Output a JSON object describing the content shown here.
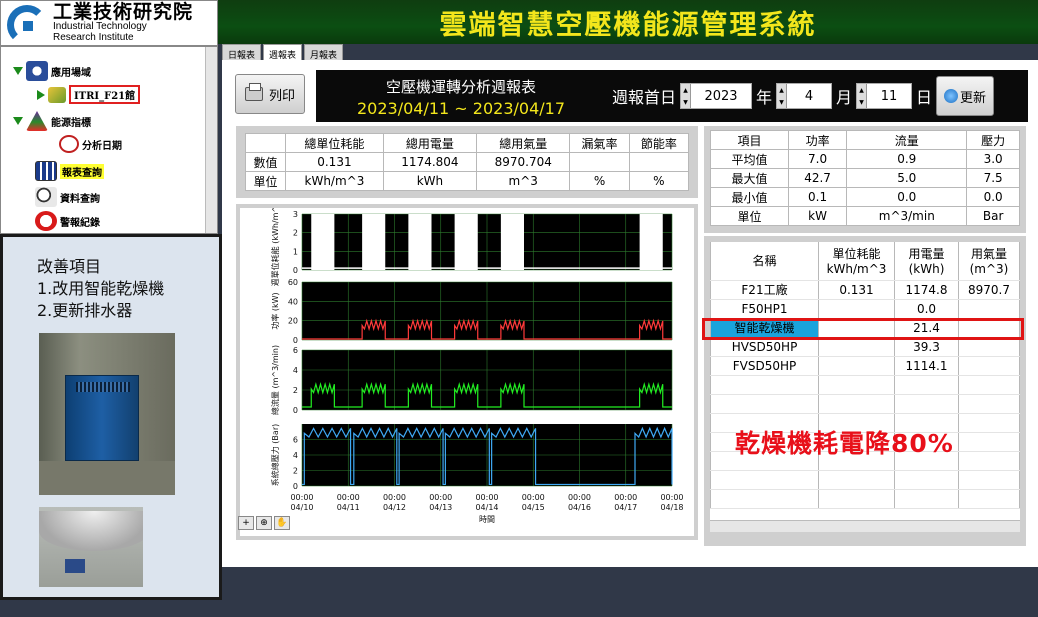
{
  "logo": {
    "zh": "工業技術研究院",
    "en1": "Industrial Technology",
    "en2": "Research Institute"
  },
  "app_title": "雲端智慧空壓機能源管理系統",
  "tree": {
    "app_site": "應用場域",
    "site_node": "ITRI_F21館",
    "energy_index": "能源指標",
    "analysis_date": "分析日期",
    "report_query": "報表查詢",
    "data_query": "資料查詢",
    "alarm_log": "警報紀錄"
  },
  "info": {
    "heading": "改善項目",
    "item1": "1.改用智能乾燥機",
    "item2": "2.更新排水器"
  },
  "tabs": [
    "日報表",
    "週報表",
    "月報表"
  ],
  "toolbar": {
    "print_label": "列印",
    "refresh_label": "更新"
  },
  "report": {
    "title": "空壓機運轉分析週報表",
    "range": "2023/04/11 ~ 2023/04/17"
  },
  "week": {
    "label": "週報首日",
    "year": "2023",
    "year_unit": "年",
    "month": "4",
    "month_unit": "月",
    "day": "11",
    "day_unit": "日"
  },
  "summary": {
    "headers": [
      "",
      "總單位耗能",
      "總用電量",
      "總用氣量",
      "漏氣率",
      "節能率"
    ],
    "rows": [
      [
        "數值",
        "0.131",
        "1174.804",
        "8970.704",
        "",
        ""
      ],
      [
        "單位",
        "kWh/m^3",
        "kWh",
        "m^3",
        "%",
        "%"
      ]
    ]
  },
  "stats": {
    "headers": [
      "項目",
      "功率",
      "流量",
      "壓力"
    ],
    "rows": [
      [
        "平均值",
        "7.0",
        "0.9",
        "3.0"
      ],
      [
        "最大值",
        "42.7",
        "5.0",
        "7.5"
      ],
      [
        "最小值",
        "0.1",
        "0.0",
        "0.0"
      ],
      [
        "單位",
        "kW",
        "m^3/min",
        "Bar"
      ]
    ]
  },
  "meters": {
    "headers": [
      "名稱",
      "單位耗能\nkWh/m^3",
      "用電量\n(kWh)",
      "用氣量\n(m^3)"
    ],
    "rows": [
      [
        "F21工廠",
        "0.131",
        "1174.8",
        "8970.7"
      ],
      [
        "F50HP1",
        "",
        "0.0",
        ""
      ],
      [
        "智能乾燥機",
        "",
        "21.4",
        ""
      ],
      [
        "HVSD50HP",
        "",
        "39.3",
        ""
      ],
      [
        "FVSD50HP",
        "",
        "1114.1",
        ""
      ]
    ]
  },
  "saving_note": "乾燥機耗電降80%",
  "chart_data": [
    {
      "type": "area",
      "ylabel": "週單位耗能 (kWh/m^3)",
      "ylim": [
        0,
        3
      ],
      "yticks": [
        "0",
        "1",
        "2",
        "3"
      ],
      "color": "#ffffff",
      "x": [
        "04/10",
        "04/11",
        "04/12",
        "04/13",
        "04/14",
        "04/15",
        "04/16",
        "04/17",
        "04/18"
      ],
      "active_windows": [
        [
          0.2,
          0.7
        ],
        [
          1.3,
          1.8
        ],
        [
          2.3,
          2.8
        ],
        [
          3.3,
          3.8
        ],
        [
          4.3,
          4.8
        ],
        [
          7.3,
          7.8
        ]
      ],
      "active_value": 3,
      "idle_value": 0.1
    },
    {
      "type": "line",
      "ylabel": "功率 (kW)",
      "ylim": [
        0,
        60
      ],
      "yticks": [
        "0",
        "20",
        "40",
        "60"
      ],
      "color": "#ff3a3a",
      "x": [
        "04/10",
        "04/11",
        "04/12",
        "04/13",
        "04/14",
        "04/15",
        "04/16",
        "04/17",
        "04/18"
      ],
      "active_windows": [
        [
          1.3,
          1.8
        ],
        [
          2.3,
          2.8
        ],
        [
          3.3,
          3.8
        ],
        [
          4.3,
          4.8
        ],
        [
          7.3,
          7.8
        ]
      ],
      "active_value": 15,
      "idle_value": 1
    },
    {
      "type": "line",
      "ylabel": "總流量 (m^3/min)",
      "ylim": [
        0,
        6
      ],
      "yticks": [
        "0",
        "2",
        "4",
        "6"
      ],
      "color": "#22ee22",
      "x": [
        "04/10",
        "04/11",
        "04/12",
        "04/13",
        "04/14",
        "04/15",
        "04/16",
        "04/17",
        "04/18"
      ],
      "active_windows": [
        [
          0.2,
          0.7
        ],
        [
          1.3,
          1.8
        ],
        [
          2.3,
          2.8
        ],
        [
          3.3,
          3.8
        ],
        [
          4.3,
          4.8
        ],
        [
          7.3,
          7.8
        ]
      ],
      "active_value": 2.1,
      "idle_value": 0.3
    },
    {
      "type": "line",
      "ylabel": "系統總壓力 (Bar)",
      "ylim": [
        0,
        8
      ],
      "yticks": [
        "0",
        "2",
        "4",
        "6"
      ],
      "color": "#3fa9f5",
      "x": [
        "04/10",
        "04/11",
        "04/12",
        "04/13",
        "04/14",
        "04/15",
        "04/16",
        "04/17",
        "04/18"
      ],
      "active_windows": [
        [
          0.05,
          1.05
        ],
        [
          1.12,
          2.05
        ],
        [
          2.1,
          3.05
        ],
        [
          3.1,
          4.05
        ],
        [
          4.1,
          5.05
        ],
        [
          7.2,
          8.0
        ]
      ],
      "active_value": 6.8,
      "idle_value": 0.2
    }
  ],
  "xaxis": {
    "label": "時間",
    "ticks": [
      [
        "00:00",
        "04/10"
      ],
      [
        "00:00",
        "04/11"
      ],
      [
        "00:00",
        "04/12"
      ],
      [
        "00:00",
        "04/13"
      ],
      [
        "00:00",
        "04/14"
      ],
      [
        "00:00",
        "04/15"
      ],
      [
        "00:00",
        "04/16"
      ],
      [
        "00:00",
        "04/17"
      ],
      [
        "00:00",
        "04/18"
      ]
    ]
  },
  "chart_tools": [
    "+",
    "⊕",
    "✋"
  ]
}
